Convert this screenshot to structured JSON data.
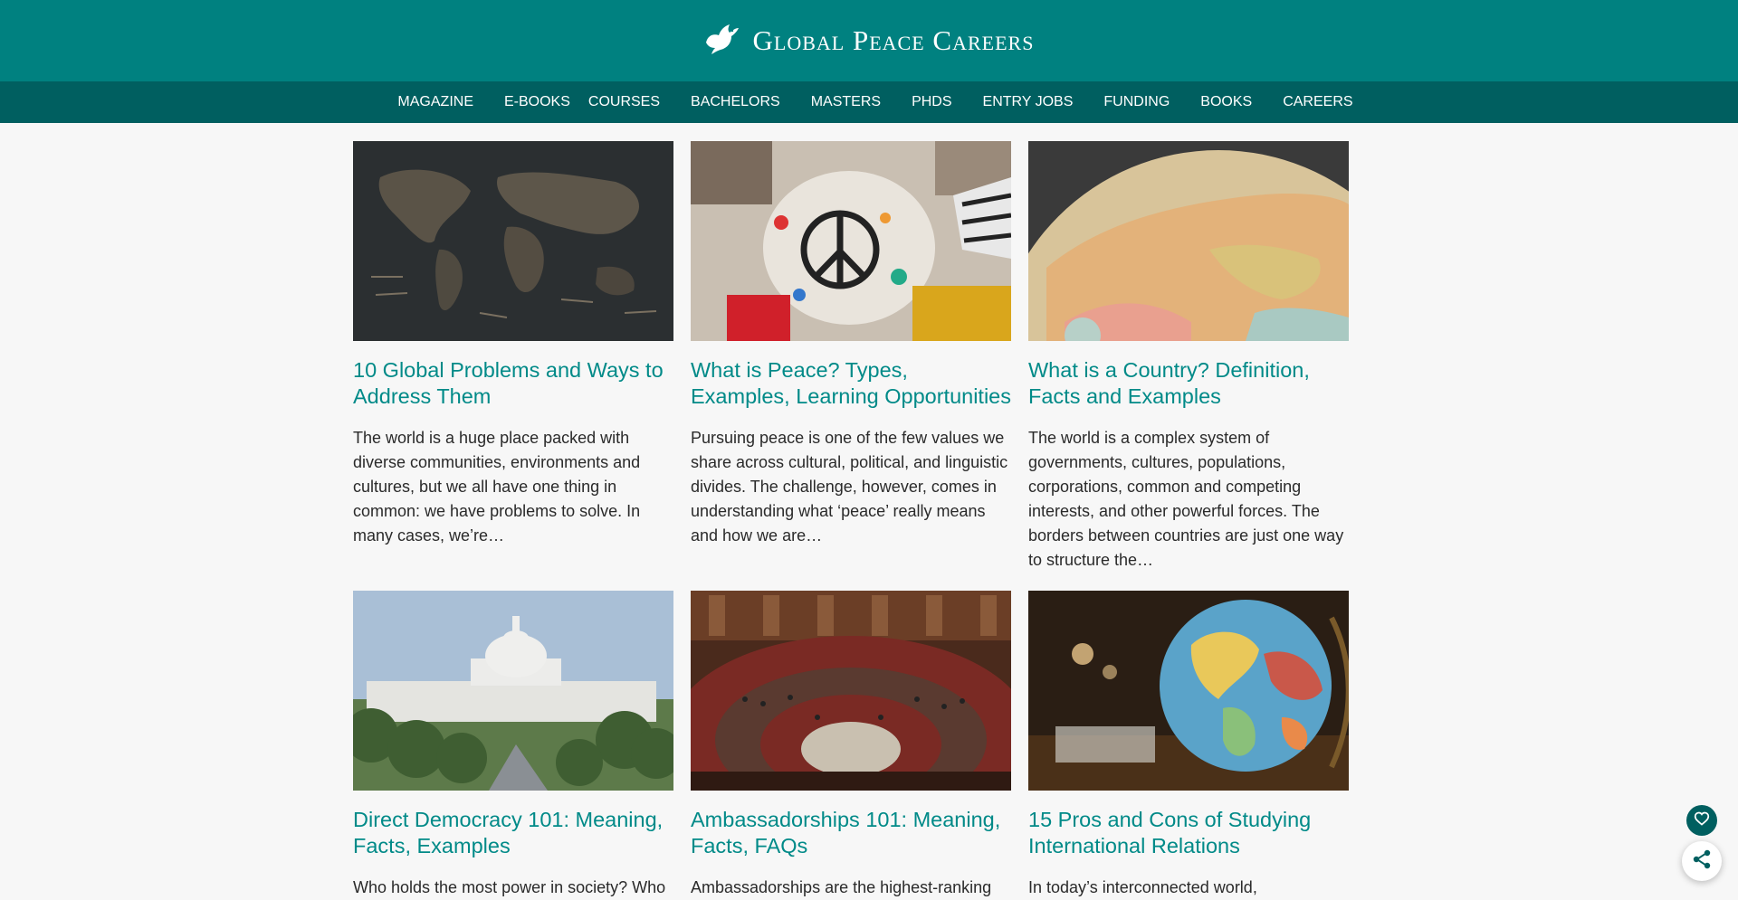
{
  "site": {
    "title": "Global Peace Careers",
    "logo_icon": "dove-icon"
  },
  "nav": [
    {
      "label": "MAGAZINE"
    },
    {
      "label": "E-BOOKS"
    },
    {
      "label": "COURSES"
    },
    {
      "label": "BACHELORS"
    },
    {
      "label": "MASTERS"
    },
    {
      "label": "PHDS"
    },
    {
      "label": "ENTRY JOBS"
    },
    {
      "label": "FUNDING"
    },
    {
      "label": "BOOKS"
    },
    {
      "label": "CAREERS"
    }
  ],
  "articles": [
    {
      "title": "10 Global Problems and Ways to Address Them",
      "excerpt": "The world is a huge place packed with diverse communities, environments and cultures, but we all have one thing in common: we have problems to solve. In many cases, we’re…"
    },
    {
      "title": "What is Peace? Types, Examples, Learning Opportunities",
      "excerpt": "Pursuing peace is one of the few values we share across cultural, political, and linguistic divides. The challenge, however, comes in understanding what ‘peace’ really means and how we are…"
    },
    {
      "title": "What is a Country? Definition, Facts and Examples",
      "excerpt": "The world is a complex system of governments, cultures, populations, corporations, common and competing interests, and other powerful forces. The borders between countries are just one way to structure the…"
    },
    {
      "title": "Direct Democracy 101: Meaning, Facts, Examples",
      "excerpt": "Who holds the most power in society? Who"
    },
    {
      "title": "Ambassadorships 101: Meaning, Facts, FAQs",
      "excerpt": "Ambassadorships are the highest-ranking"
    },
    {
      "title": "15 Pros and Cons of Studying International Relations",
      "excerpt": "In today’s interconnected world,"
    }
  ],
  "colors": {
    "header": "#008180",
    "nav": "#005f60",
    "link": "#008a88",
    "body_text": "#2a2a2a"
  },
  "floating": {
    "favorite_icon": "heart-icon",
    "share_icon": "share-icon"
  }
}
